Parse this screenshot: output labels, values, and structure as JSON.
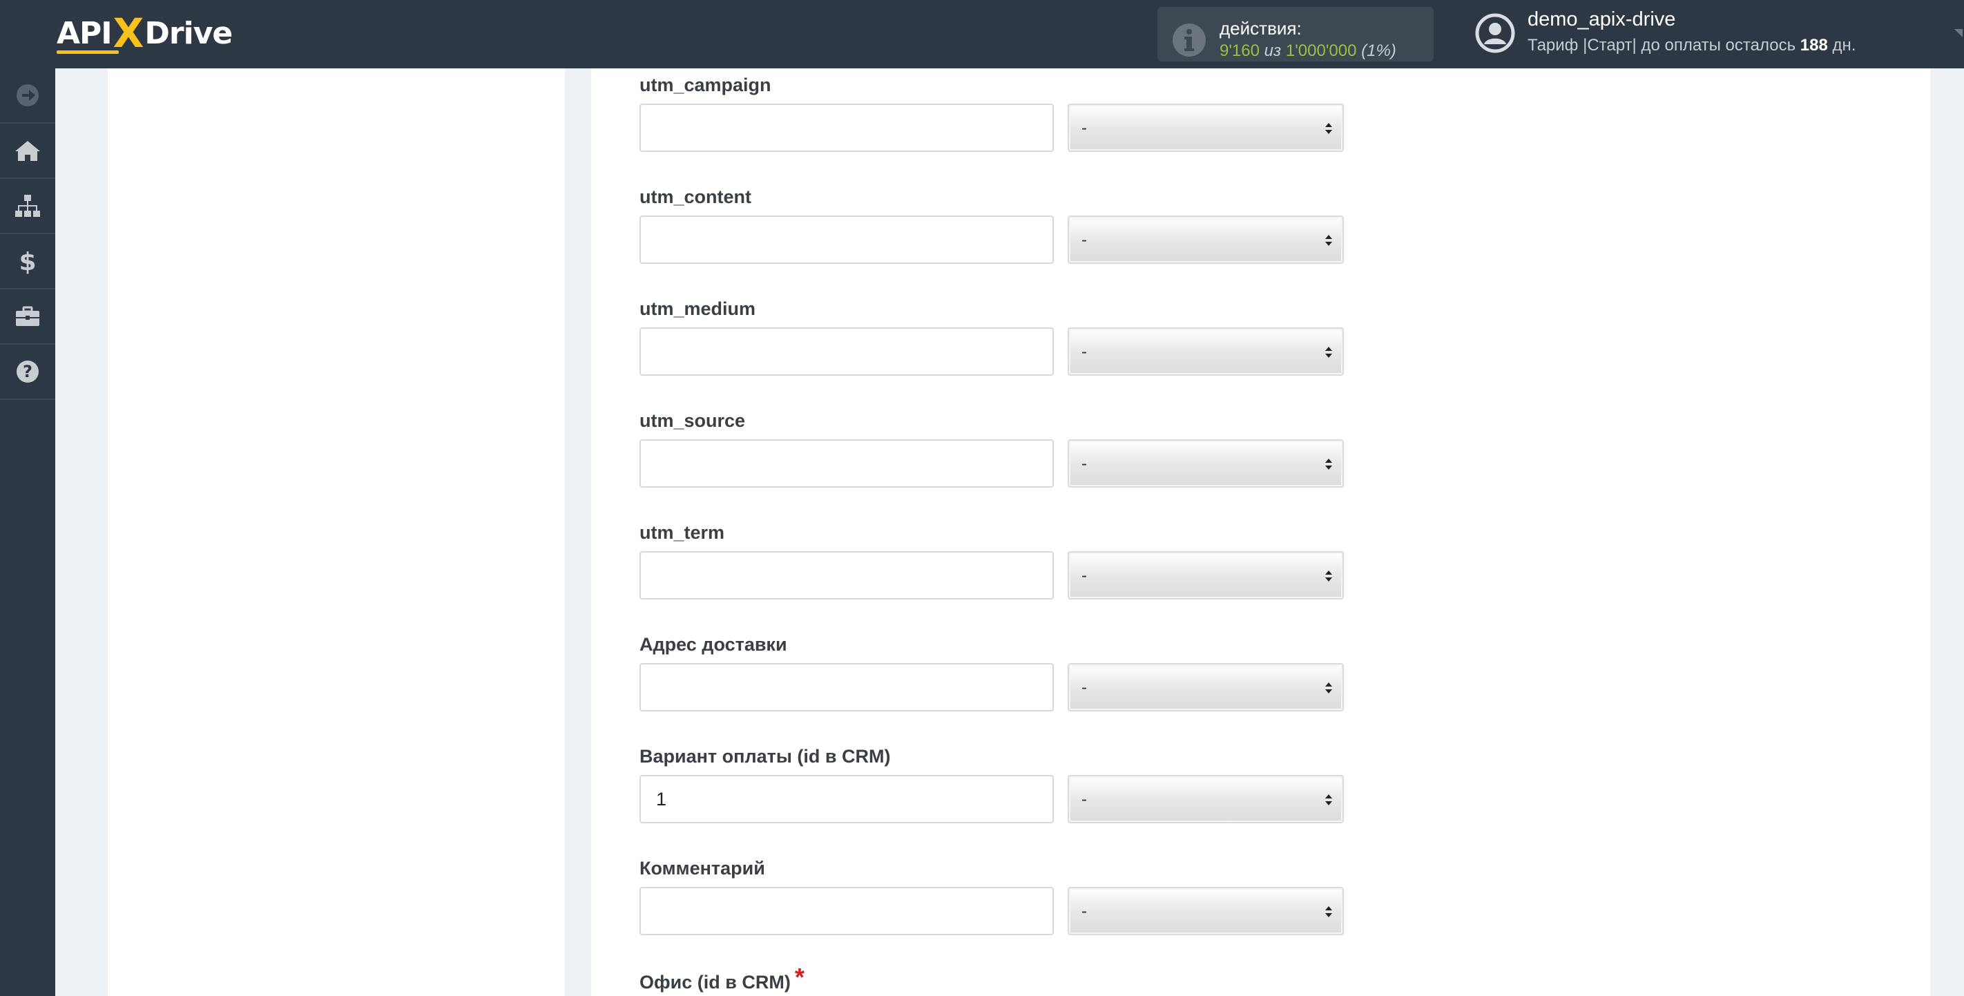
{
  "header": {
    "logo": {
      "left": "API",
      "x": "X",
      "right": "Drive"
    },
    "actions": {
      "label": "действия:",
      "used": "9'160",
      "of": "из",
      "total": "1'000'000",
      "percent": "(1%)"
    },
    "user": {
      "name": "demo_apix-drive",
      "plan_text": "Тариф |Старт| до оплаты осталось",
      "days": "188",
      "days_unit": "дн."
    }
  },
  "sidebar": {
    "items": [
      {
        "icon": "arrow-circle-right-icon"
      },
      {
        "icon": "home-icon"
      },
      {
        "icon": "sitemap-icon"
      },
      {
        "icon": "dollar-icon"
      },
      {
        "icon": "briefcase-icon"
      },
      {
        "icon": "question-circle-icon"
      }
    ]
  },
  "form": {
    "fields": [
      {
        "label": "utm_campaign",
        "value": "",
        "select": "-"
      },
      {
        "label": "utm_content",
        "value": "",
        "select": "-"
      },
      {
        "label": "utm_medium",
        "value": "",
        "select": "-"
      },
      {
        "label": "utm_source",
        "value": "",
        "select": "-"
      },
      {
        "label": "utm_term",
        "value": "",
        "select": "-"
      },
      {
        "label": "Адрес доставки",
        "value": "",
        "select": "-"
      },
      {
        "label": "Вариант оплаты (id в CRM)",
        "value": "1",
        "select": "-"
      },
      {
        "label": "Комментарий",
        "value": "",
        "select": "-"
      }
    ],
    "last_field": {
      "label": "Офис (id в CRM)",
      "required_mark": "*"
    }
  },
  "colors": {
    "topbar": "#2e3844",
    "accent_yellow": "#f7c21a",
    "actions_green": "#9bc03f",
    "required_red": "#d02020"
  }
}
